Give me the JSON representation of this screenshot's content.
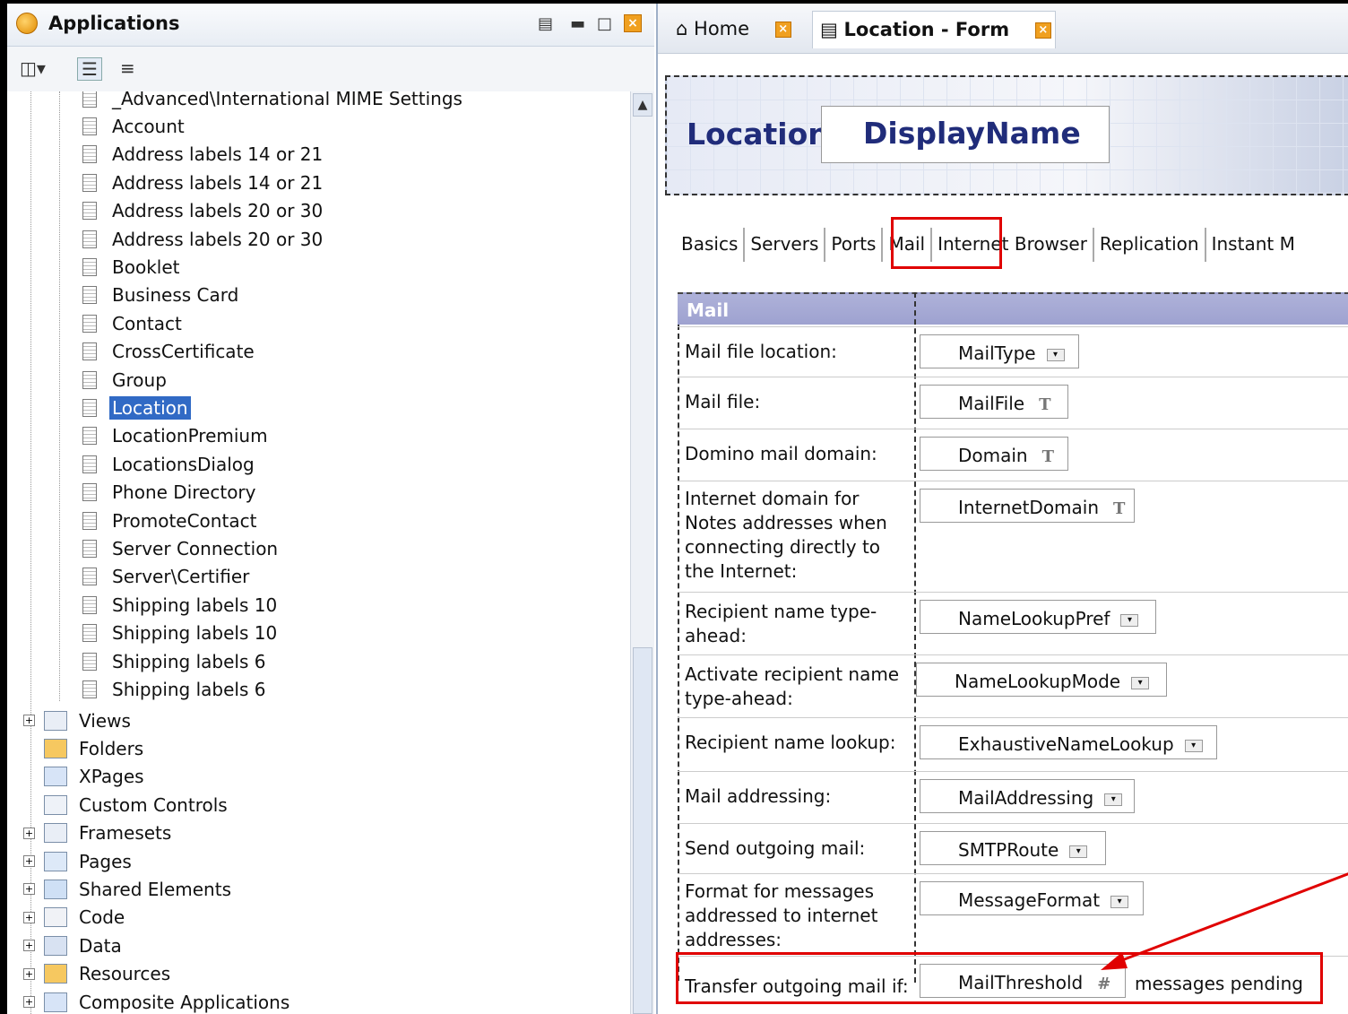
{
  "applications_panel": {
    "title": "Applications",
    "tree_items": [
      "_Advanced\\International MIME Settings",
      "Account",
      "Address labels 14 or 21",
      "Address labels 14 or 21",
      "Address labels 20 or 30",
      "Address labels 20 or 30",
      "Booklet",
      "Business Card",
      "Contact",
      "CrossCertificate",
      "Group",
      "Location",
      "LocationPremium",
      "LocationsDialog",
      "Phone Directory",
      "PromoteContact",
      "Server Connection",
      "Server\\Certifier",
      "Shipping labels 10",
      "Shipping labels 10",
      "Shipping labels 6",
      "Shipping labels 6"
    ],
    "selected_item": "Location",
    "categories": [
      {
        "label": "Views",
        "expand": "+"
      },
      {
        "label": "Folders",
        "expand": ""
      },
      {
        "label": "XPages",
        "expand": ""
      },
      {
        "label": "Custom Controls",
        "expand": ""
      },
      {
        "label": "Framesets",
        "expand": "+"
      },
      {
        "label": "Pages",
        "expand": "+"
      },
      {
        "label": "Shared Elements",
        "expand": "+"
      },
      {
        "label": "Code",
        "expand": "+"
      },
      {
        "label": "Data",
        "expand": "+"
      },
      {
        "label": "Resources",
        "expand": "+"
      },
      {
        "label": "Composite Applications",
        "expand": "+"
      }
    ]
  },
  "editor_tabs": {
    "home": "Home",
    "form": "Location - Form"
  },
  "form": {
    "banner_label": "Location",
    "banner_field": "DisplayName",
    "tabs": [
      "Basics",
      "Servers",
      "Ports",
      "Mail",
      "Internet Browser",
      "Replication",
      "Instant M"
    ],
    "section_title": "Mail",
    "rows": [
      {
        "label": "Mail file location:",
        "field": "MailType",
        "kind": "dropdown"
      },
      {
        "label": "Mail file:",
        "field": "MailFile",
        "kind": "text",
        "type_mark": "T"
      },
      {
        "label": "Domino mail domain:",
        "field": "Domain",
        "kind": "text",
        "type_mark": "T"
      },
      {
        "label": "Internet domain for Notes addresses when connecting directly to the Internet:",
        "field": "InternetDomain",
        "kind": "text",
        "type_mark": "T"
      },
      {
        "label": "Recipient name type-ahead:",
        "field": "NameLookupPref",
        "kind": "dropdown"
      },
      {
        "label": "Activate recipient name type-ahead:",
        "field": "NameLookupMode",
        "kind": "dropdown"
      },
      {
        "label": "Recipient name lookup:",
        "field": "ExhaustiveNameLookup",
        "kind": "dropdown"
      },
      {
        "label": "Mail addressing:",
        "field": "MailAddressing",
        "kind": "dropdown"
      },
      {
        "label": "Send outgoing mail:",
        "field": "SMTPRoute",
        "kind": "dropdown"
      },
      {
        "label": "Format for messages addressed to internet addresses:",
        "field": "MessageFormat",
        "kind": "dropdown"
      },
      {
        "label": "Transfer outgoing mail if:",
        "field": "MailThreshold",
        "kind": "number",
        "type_mark": "#",
        "suffix": "messages pending"
      }
    ]
  },
  "colors": {
    "highlight": "#e00000",
    "selection": "#316ac5",
    "title_blue": "#202c7a"
  }
}
